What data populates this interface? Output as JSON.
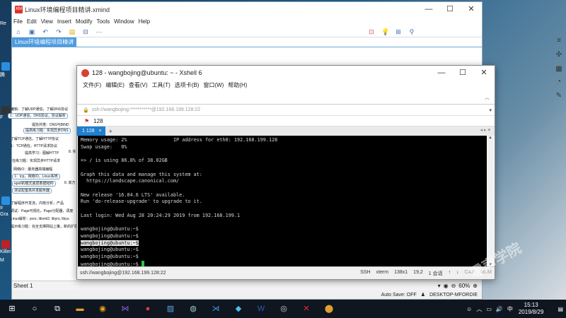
{
  "desktop": {
    "left_labels": [
      "Re",
      "腾",
      "F",
      "Ir",
      "Gra",
      "Killer",
      "M"
    ],
    "mindmap_nodes": [
      "编辑：了解UDP通信，了解DNS协议",
      "1：UDP通信，DNS协议，协议解析",
      "提协并搭：DNS与BIND",
      "提高练习题：实现异步DNS",
      "了解TCP通信，了解HTTP协议",
      "1：TCP通信，HTTP请求协议",
      "提高学习：图解HTTP",
      "在练习题：实现异步HTTP请求",
      "网络IO：服务器高端编程",
      "1：tcp，网络IO，Linux系统",
      "epoll的模式底层数据结构",
      "测试配置高并发服务器",
      "了解程序开发流，内核分析，产品",
      "调试：Page可视化，Page分配器，调度",
      "Linux解析：pcre, libxml2, libyrs, libyu",
      "提示练习题：完全支撑网站上策，新的扩展",
      "8. 高万 ...",
      "8. 实 ..."
    ]
  },
  "xmind": {
    "title": "Linux环境编程项目精讲.xmind",
    "logo": "XM",
    "menu": [
      "File",
      "Edit",
      "View",
      "Insert",
      "Modify",
      "Tools",
      "Window",
      "Help"
    ],
    "tab": "Linux环境编程项目精讲",
    "sheet": "Sheet 1",
    "zoom": "60%",
    "autosave": "Auto Save: OFF",
    "location": "DESKTOP-MFORDIE"
  },
  "xshell": {
    "title": "128 - wangbojing@ubuntu: ~ - Xshell 6",
    "menu": [
      "文件(F)",
      "编辑(E)",
      "查看(V)",
      "工具(T)",
      "选项卡(B)",
      "窗口(W)",
      "帮助(H)"
    ],
    "address": "ssh://wangbojing:***********@192.168.199.128:22",
    "session": "128",
    "tab": "1 128",
    "terminal": {
      "mem_line": "Memory usage: 2%                IP address for eth0: 192.168.199.128",
      "swap_line": "Swap usage:   0%",
      "disk_line": "=> / is using 86.8% of 38.02GB",
      "graph_line": "Graph this data and manage this system at:",
      "graph_url": "  https://landscape.canonical.com/",
      "release_line": "New release '16.04.6 LTS' available.",
      "upgrade_line": "Run 'do-release-upgrade' to upgrade to it.",
      "login_line": "Last login: Wed Aug 28 20:24:29 2019 from 192.168.199.1",
      "prompt": "wangbojing@ubuntu:~$"
    },
    "status": {
      "connection": "ssh://wangbojing@192.168.199.128:22",
      "protocol": "SSH",
      "terminal_type": "xterm",
      "size": "138x1",
      "cursor": "19,2",
      "sessions": "1 会话",
      "cap": "CAP",
      "num": "NUM"
    }
  },
  "taskbar": {
    "lang": "中",
    "time": "15:13",
    "date": "2019/8/29"
  },
  "watermark": "零声学院"
}
